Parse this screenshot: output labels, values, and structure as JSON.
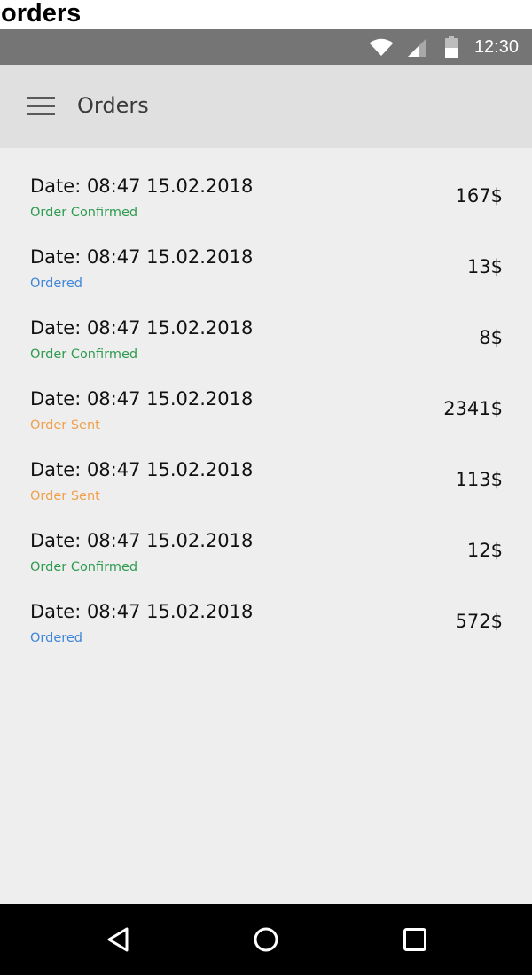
{
  "caption": "orders",
  "status_bar": {
    "time": "12:30",
    "icons": [
      "wifi-icon",
      "signal-icon",
      "battery-icon"
    ]
  },
  "app_bar": {
    "title": "Orders",
    "menu_icon": "hamburger-menu-icon"
  },
  "colors": {
    "confirmed": "#2e9b4f",
    "ordered": "#3f86d8",
    "sent": "#f0a04b",
    "app_bar": "#e0e0e0",
    "content": "#eeeeee",
    "status_bar": "#757575"
  },
  "orders": [
    {
      "date": "Date:  08:47 15.02.2018",
      "status": "Order Confirmed",
      "status_type": "confirmed",
      "amount": "167$"
    },
    {
      "date": "Date:  08:47 15.02.2018",
      "status": "Ordered",
      "status_type": "ordered",
      "amount": "13$"
    },
    {
      "date": "Date:  08:47 15.02.2018",
      "status": "Order Confirmed",
      "status_type": "confirmed",
      "amount": "8$"
    },
    {
      "date": "Date:  08:47 15.02.2018",
      "status": "Order Sent",
      "status_type": "sent",
      "amount": "2341$"
    },
    {
      "date": "Date:  08:47 15.02.2018",
      "status": "Order Sent",
      "status_type": "sent",
      "amount": "113$"
    },
    {
      "date": "Date:  08:47 15.02.2018",
      "status": "Order Confirmed",
      "status_type": "confirmed",
      "amount": "12$"
    },
    {
      "date": "Date:  08:47 15.02.2018",
      "status": "Ordered",
      "status_type": "ordered",
      "amount": "572$"
    }
  ],
  "nav_bar": {
    "icons": [
      "back-icon",
      "home-icon",
      "recents-icon"
    ]
  }
}
